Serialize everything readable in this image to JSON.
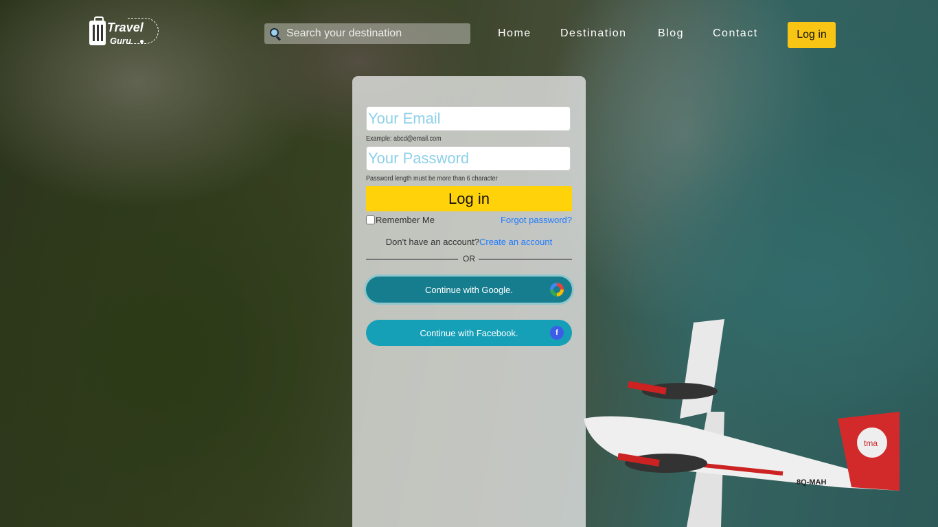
{
  "brand": {
    "line1": "Travel",
    "line2": "Guru"
  },
  "search": {
    "placeholder": "Search your destination"
  },
  "nav": {
    "items": [
      "Home",
      "Destination",
      "Blog",
      "Contact"
    ],
    "login_label": "Log in"
  },
  "form": {
    "email_placeholder": "Your Email",
    "email_hint": "Example: abcd@email.com",
    "password_placeholder": "Your Password",
    "password_hint": "Password length must be more than 6 character",
    "login_label": "Log in",
    "remember_label": "Remember Me",
    "forgot_label": "Forgot password?",
    "signup_prompt": "Don't have an account?",
    "signup_link": "Create an account",
    "or_label": "OR",
    "google_label": "Continue with Google.",
    "facebook_label": "Continue with Facebook.",
    "facebook_icon_letter": "f"
  },
  "colors": {
    "accent": "#f9c515",
    "login_button": "#ffd20a",
    "google_button": "#167d8f",
    "facebook_button": "#16a0b8",
    "link": "#1f7bff"
  },
  "plane_registration": "8Q-MAH",
  "plane_logo": "tma"
}
